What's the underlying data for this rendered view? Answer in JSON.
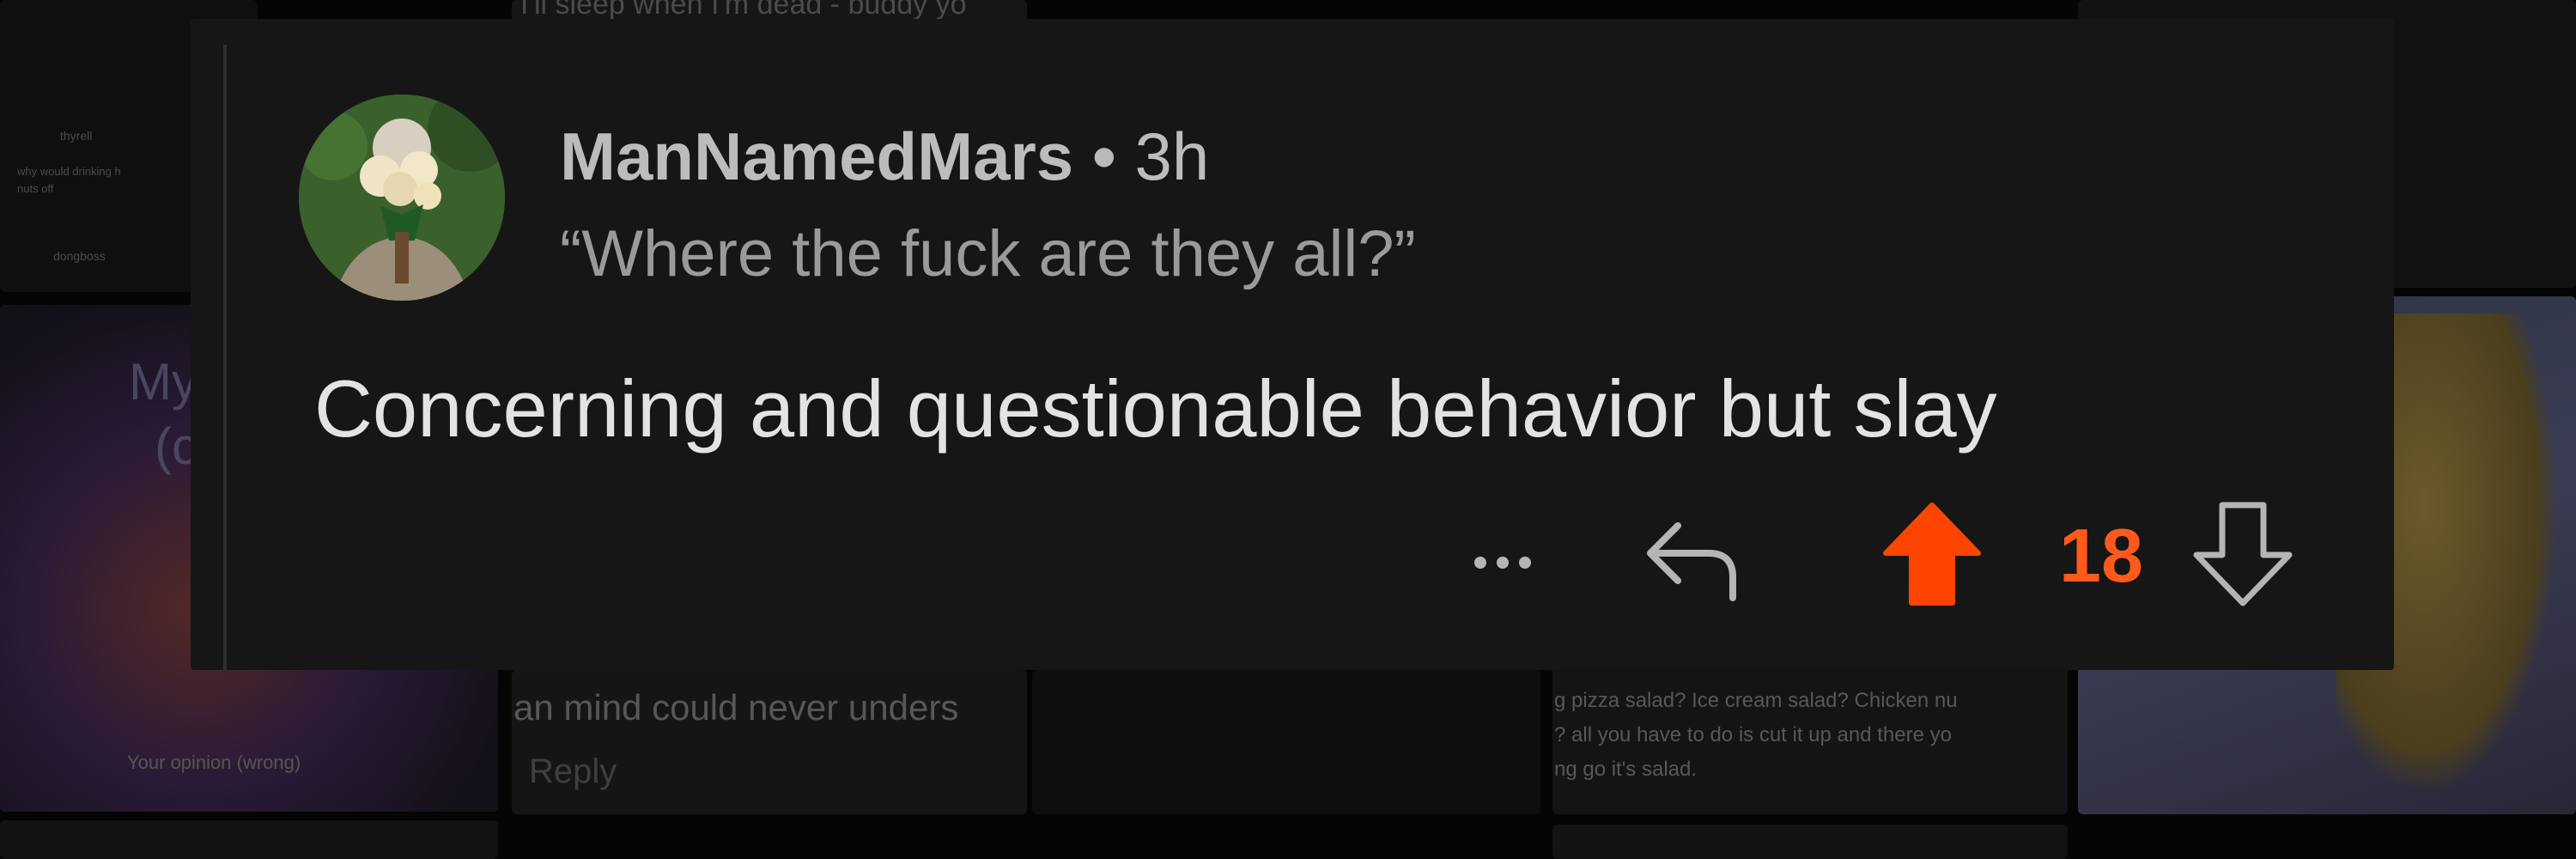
{
  "comment": {
    "username": "ManNamedMars",
    "separator": "•",
    "timestamp": "3h",
    "flair": "“Where the fuck are they all?”",
    "body": "Concerning and questionable behavior but slay",
    "vote_count": "18",
    "upvoted": true
  },
  "actions": {
    "more_icon": "ellipsis-icon",
    "reply_icon": "reply-arrow-icon",
    "upvote_icon": "upvote-arrow-icon",
    "downvote_icon": "downvote-arrow-icon"
  },
  "background": {
    "tile_d_text": "an mind could never unders",
    "tile_d_reply": "Reply",
    "tile_f_lines": [
      "g pizza salad? Ice cream salad? Chicken nu",
      "? all you have to do is cut it up and there yo",
      "ng go it's salad."
    ],
    "tile_c_text": "I'll sleep when I'm dead - buddy yo",
    "tile_a_user": "thyrell",
    "tile_a_text": "why would drinking h",
    "tile_a_text2": "nuts off",
    "tile_a_user2": "dongboss",
    "tile_b_caption": "Your opinion (wrong)",
    "tile_b_letters": "My",
    "tile_b_letters2": "(c"
  },
  "colors": {
    "card_bg": "#161616",
    "accent_upvote": "#ff4500",
    "vote_count": "#ff5a1c",
    "icon_gray": "#b5b5b5"
  }
}
